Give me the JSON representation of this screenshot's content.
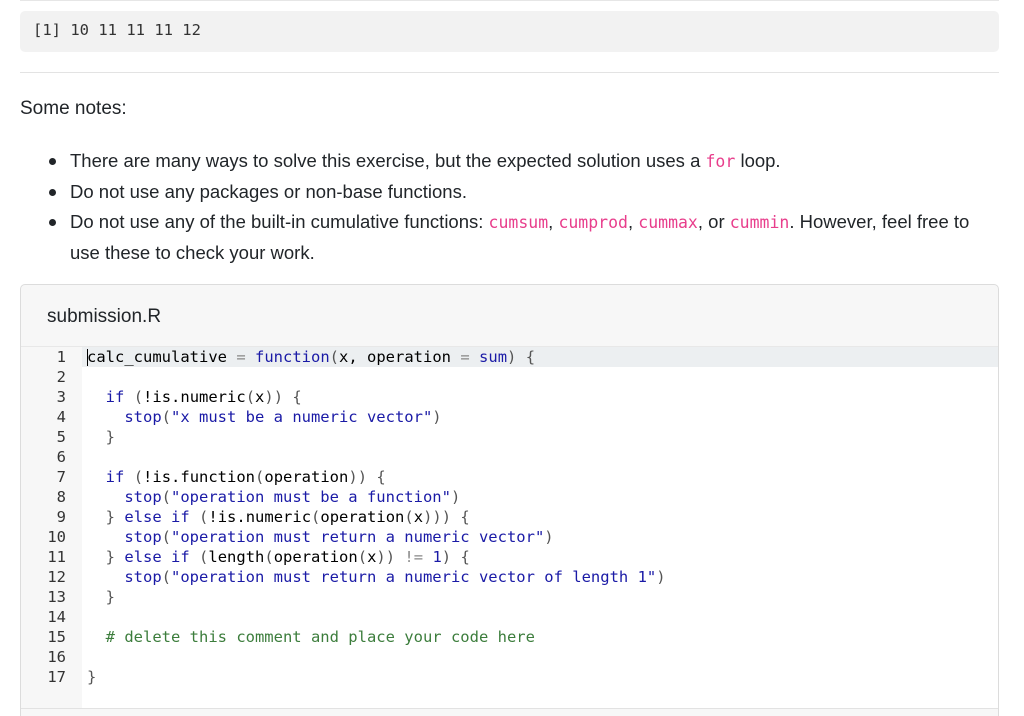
{
  "output": {
    "text": "[1] 10 11 11 11 12"
  },
  "notes": {
    "heading": "Some notes:",
    "items": [
      [
        {
          "t": "There are many ways to solve this exercise, but the expected solution uses a ",
          "code": false
        },
        {
          "t": "for",
          "code": true
        },
        {
          "t": " loop.",
          "code": false
        }
      ],
      [
        {
          "t": "Do not use any packages or non-base functions.",
          "code": false
        }
      ],
      [
        {
          "t": "Do not use any of the built-in cumulative functions: ",
          "code": false
        },
        {
          "t": "cumsum",
          "code": true
        },
        {
          "t": ", ",
          "code": false
        },
        {
          "t": "cumprod",
          "code": true
        },
        {
          "t": ", ",
          "code": false
        },
        {
          "t": "cummax",
          "code": true
        },
        {
          "t": ", or ",
          "code": false
        },
        {
          "t": "cummin",
          "code": true
        },
        {
          "t": ". However, feel free to use these to check your work.",
          "code": false
        }
      ]
    ]
  },
  "editor": {
    "filename": "submission.R",
    "line_numbers": [
      "1",
      "2",
      "3",
      "4",
      "5",
      "6",
      "7",
      "8",
      "9",
      "10",
      "11",
      "12",
      "13",
      "14",
      "15",
      "16",
      "17"
    ],
    "lines": [
      [
        [
          "ident",
          "calc_cumulative"
        ],
        [
          "plain",
          " "
        ],
        [
          "op",
          "="
        ],
        [
          "plain",
          " "
        ],
        [
          "fn",
          "function"
        ],
        [
          "punc",
          "("
        ],
        [
          "ident",
          "x, operation"
        ],
        [
          "plain",
          " "
        ],
        [
          "op",
          "="
        ],
        [
          "plain",
          " "
        ],
        [
          "fn",
          "sum"
        ],
        [
          "punc",
          ")"
        ],
        [
          "plain",
          " "
        ],
        [
          "punc",
          "{"
        ]
      ],
      [],
      [
        [
          "plain",
          "  "
        ],
        [
          "kw",
          "if"
        ],
        [
          "plain",
          " "
        ],
        [
          "punc",
          "("
        ],
        [
          "ident",
          "!is.numeric"
        ],
        [
          "punc",
          "("
        ],
        [
          "ident",
          "x"
        ],
        [
          "punc",
          "))"
        ],
        [
          "plain",
          " "
        ],
        [
          "punc",
          "{"
        ]
      ],
      [
        [
          "plain",
          "    "
        ],
        [
          "fn",
          "stop"
        ],
        [
          "punc",
          "("
        ],
        [
          "str",
          "\"x must be a numeric vector\""
        ],
        [
          "punc",
          ")"
        ]
      ],
      [
        [
          "plain",
          "  "
        ],
        [
          "punc",
          "}"
        ]
      ],
      [],
      [
        [
          "plain",
          "  "
        ],
        [
          "kw",
          "if"
        ],
        [
          "plain",
          " "
        ],
        [
          "punc",
          "("
        ],
        [
          "ident",
          "!is.function"
        ],
        [
          "punc",
          "("
        ],
        [
          "ident",
          "operation"
        ],
        [
          "punc",
          "))"
        ],
        [
          "plain",
          " "
        ],
        [
          "punc",
          "{"
        ]
      ],
      [
        [
          "plain",
          "    "
        ],
        [
          "fn",
          "stop"
        ],
        [
          "punc",
          "("
        ],
        [
          "str",
          "\"operation must be a function\""
        ],
        [
          "punc",
          ")"
        ]
      ],
      [
        [
          "plain",
          "  "
        ],
        [
          "punc",
          "}"
        ],
        [
          "plain",
          " "
        ],
        [
          "kw",
          "else if"
        ],
        [
          "plain",
          " "
        ],
        [
          "punc",
          "("
        ],
        [
          "ident",
          "!is.numeric"
        ],
        [
          "punc",
          "("
        ],
        [
          "ident",
          "operation"
        ],
        [
          "punc",
          "("
        ],
        [
          "ident",
          "x"
        ],
        [
          "punc",
          ")))"
        ],
        [
          "plain",
          " "
        ],
        [
          "punc",
          "{"
        ]
      ],
      [
        [
          "plain",
          "    "
        ],
        [
          "fn",
          "stop"
        ],
        [
          "punc",
          "("
        ],
        [
          "str",
          "\"operation must return a numeric vector\""
        ],
        [
          "punc",
          ")"
        ]
      ],
      [
        [
          "plain",
          "  "
        ],
        [
          "punc",
          "}"
        ],
        [
          "plain",
          " "
        ],
        [
          "kw",
          "else if"
        ],
        [
          "plain",
          " "
        ],
        [
          "punc",
          "("
        ],
        [
          "ident",
          "length"
        ],
        [
          "punc",
          "("
        ],
        [
          "ident",
          "operation"
        ],
        [
          "punc",
          "("
        ],
        [
          "ident",
          "x"
        ],
        [
          "punc",
          "))"
        ],
        [
          "plain",
          " "
        ],
        [
          "op",
          "!="
        ],
        [
          "plain",
          " "
        ],
        [
          "num",
          "1"
        ],
        [
          "punc",
          ")"
        ],
        [
          "plain",
          " "
        ],
        [
          "punc",
          "{"
        ]
      ],
      [
        [
          "plain",
          "    "
        ],
        [
          "fn",
          "stop"
        ],
        [
          "punc",
          "("
        ],
        [
          "str",
          "\"operation must return a numeric vector of length 1\""
        ],
        [
          "punc",
          ")"
        ]
      ],
      [
        [
          "plain",
          "  "
        ],
        [
          "punc",
          "}"
        ]
      ],
      [],
      [
        [
          "plain",
          "  "
        ],
        [
          "comment",
          "# delete this comment and place your code here"
        ]
      ],
      [],
      [
        [
          "punc",
          "}"
        ]
      ]
    ]
  }
}
